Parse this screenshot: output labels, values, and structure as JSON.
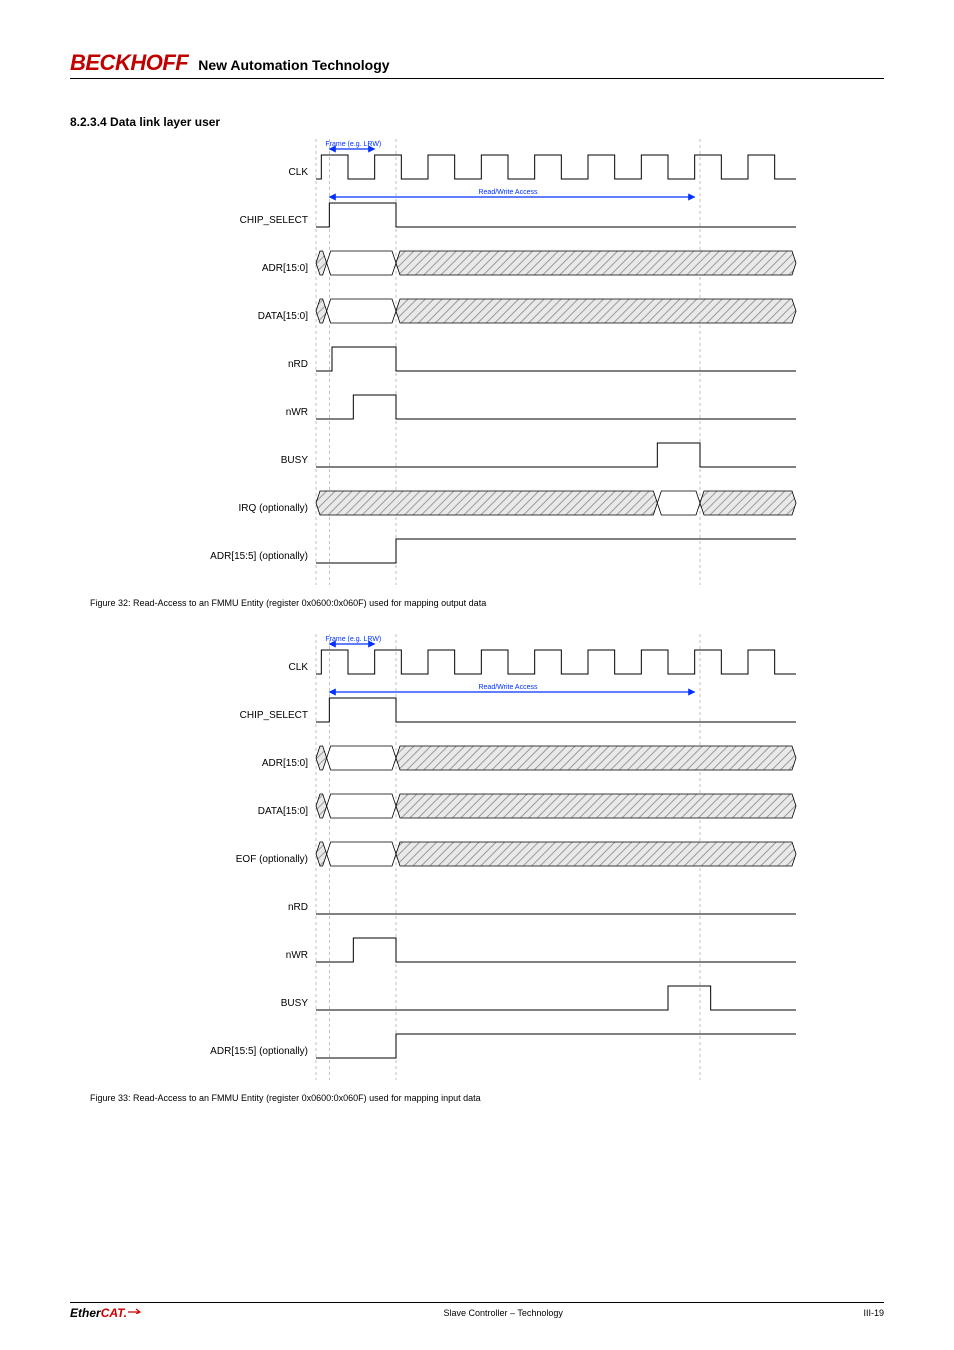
{
  "header": {
    "brand": "BECKHOFF",
    "tagline": "New Automation Technology",
    "docid": ""
  },
  "section": {
    "title": "8.2.3.4 Data link layer user"
  },
  "fig1": {
    "caption": "Figure 32: Read-Access to an FMMU Entity (register 0x0600:0x060F) used for mapping output data",
    "top_arrow_label": "Frame (e.g. LRW)",
    "mid_arrow_label": "Read/Write Access",
    "labels": [
      "CLK",
      "CHIP_SELECT",
      "ADR[15:0]",
      "DATA[15:0]",
      "nRD",
      "nWR",
      "BUSY",
      "IRQ (optionally)",
      "ADR[15:5] (optionally)"
    ]
  },
  "fig2": {
    "caption": "Figure 33: Read-Access to an FMMU Entity (register 0x0600:0x060F) used for mapping input data",
    "top_arrow_label": "Frame (e.g. LRW)",
    "mid_arrow_label": "Read/Write Access",
    "labels": [
      "CLK",
      "CHIP_SELECT",
      "ADR[15:0]",
      "DATA[15:0]",
      "EOF (optionally)",
      "nRD",
      "nWR",
      "BUSY",
      "ADR[15:5] (optionally)"
    ]
  },
  "footer": {
    "left_logo": "EtherCAT.",
    "center": "Slave Controller – Technology",
    "right": "III-19"
  },
  "chart_data": [
    {
      "type": "timing-diagram",
      "id": "fig32",
      "title": "Read-Access to an FMMU Entity (register 0x0600:0x060F) used for mapping output data",
      "x_range_clk_cycles": 9,
      "series": [
        {
          "name": "CLK",
          "kind": "clock",
          "period_cycles": 1,
          "duty": 0.5
        },
        {
          "name": "CHIP_SELECT",
          "kind": "digital",
          "segments": [
            [
              0,
              0.25,
              0
            ],
            [
              0.25,
              1.5,
              1
            ],
            [
              1.5,
              9,
              0
            ]
          ]
        },
        {
          "name": "ADR[15:0]",
          "kind": "bus",
          "segments": [
            [
              0,
              0.2,
              "invalid"
            ],
            [
              0.2,
              1.5,
              "valid"
            ],
            [
              1.5,
              9,
              "invalid"
            ]
          ]
        },
        {
          "name": "DATA[15:0]",
          "kind": "bus",
          "segments": [
            [
              0,
              0.2,
              "invalid"
            ],
            [
              0.2,
              1.5,
              "valid"
            ],
            [
              1.5,
              9,
              "invalid"
            ]
          ]
        },
        {
          "name": "nRD",
          "kind": "digital",
          "segments": [
            [
              0,
              0.3,
              0
            ],
            [
              0.3,
              1.5,
              1
            ],
            [
              1.5,
              9,
              0
            ]
          ]
        },
        {
          "name": "nWR",
          "kind": "digital",
          "segments": [
            [
              0,
              0.7,
              0
            ],
            [
              0.7,
              1.5,
              1
            ],
            [
              1.5,
              9,
              0
            ]
          ]
        },
        {
          "name": "BUSY",
          "kind": "digital",
          "segments": [
            [
              0,
              6.4,
              0
            ],
            [
              6.4,
              7.2,
              1
            ],
            [
              7.2,
              9,
              0
            ]
          ]
        },
        {
          "name": "IRQ (optionally)",
          "kind": "bus",
          "segments": [
            [
              0,
              6.4,
              "invalid"
            ],
            [
              6.4,
              7.2,
              "valid"
            ],
            [
              7.2,
              9,
              "invalid"
            ]
          ]
        },
        {
          "name": "ADR[15:5] (optionally)",
          "kind": "digital",
          "segments": [
            [
              0,
              1.5,
              0
            ],
            [
              1.5,
              9,
              1
            ]
          ]
        }
      ]
    },
    {
      "type": "timing-diagram",
      "id": "fig33",
      "title": "Read-Access to an FMMU Entity (register 0x0600:0x060F) used for mapping input data",
      "x_range_clk_cycles": 9,
      "series": [
        {
          "name": "CLK",
          "kind": "clock",
          "period_cycles": 1,
          "duty": 0.5
        },
        {
          "name": "CHIP_SELECT",
          "kind": "digital",
          "segments": [
            [
              0,
              0.25,
              0
            ],
            [
              0.25,
              1.5,
              1
            ],
            [
              1.5,
              9,
              0
            ]
          ]
        },
        {
          "name": "ADR[15:0]",
          "kind": "bus",
          "segments": [
            [
              0,
              0.2,
              "invalid"
            ],
            [
              0.2,
              1.5,
              "valid"
            ],
            [
              1.5,
              9,
              "invalid"
            ]
          ]
        },
        {
          "name": "DATA[15:0]",
          "kind": "bus",
          "segments": [
            [
              0,
              0.2,
              "invalid"
            ],
            [
              0.2,
              1.5,
              "valid"
            ],
            [
              1.5,
              9,
              "invalid"
            ]
          ]
        },
        {
          "name": "EOF (optionally)",
          "kind": "bus",
          "segments": [
            [
              0,
              0.2,
              "invalid"
            ],
            [
              0.2,
              1.5,
              "valid"
            ],
            [
              1.5,
              9,
              "invalid"
            ]
          ]
        },
        {
          "name": "nRD",
          "kind": "digital",
          "segments": [
            [
              0,
              9,
              0
            ]
          ]
        },
        {
          "name": "nWR",
          "kind": "digital",
          "segments": [
            [
              0,
              0.7,
              0
            ],
            [
              0.7,
              1.5,
              1
            ],
            [
              1.5,
              9,
              0
            ]
          ]
        },
        {
          "name": "BUSY",
          "kind": "digital",
          "segments": [
            [
              0,
              6.6,
              0
            ],
            [
              6.6,
              7.4,
              1
            ],
            [
              7.4,
              9,
              0
            ]
          ]
        },
        {
          "name": "ADR[15:5] (optionally)",
          "kind": "digital",
          "segments": [
            [
              0,
              1.5,
              0
            ],
            [
              1.5,
              9,
              1
            ]
          ]
        }
      ]
    }
  ]
}
